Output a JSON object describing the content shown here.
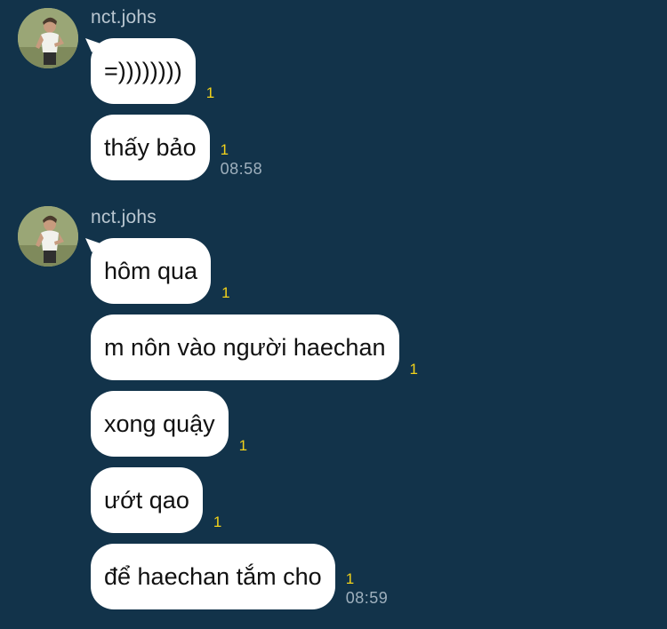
{
  "chat": {
    "groups": [
      {
        "sender": "nct.johs",
        "messages": [
          {
            "text": "=))))))))",
            "read": "1",
            "time": ""
          },
          {
            "text": "thấy bảo",
            "read": "1",
            "time": "08:58"
          }
        ]
      },
      {
        "sender": "nct.johs",
        "messages": [
          {
            "text": "hôm qua",
            "read": "1",
            "time": ""
          },
          {
            "text": "m nôn vào người haechan",
            "read": "1",
            "time": ""
          },
          {
            "text": "xong quậy",
            "read": "1",
            "time": ""
          },
          {
            "text": "ướt qao",
            "read": "1",
            "time": ""
          },
          {
            "text": "để haechan tắm cho",
            "read": "1",
            "time": "08:59"
          }
        ]
      }
    ]
  },
  "colors": {
    "background": "#12334a",
    "bubble": "#ffffff",
    "read_indicator": "#f2d21a",
    "timestamp": "#9fb0bd",
    "sender_name": "#b9c6d0"
  },
  "icons": {
    "avatar": "user-avatar-photo"
  }
}
